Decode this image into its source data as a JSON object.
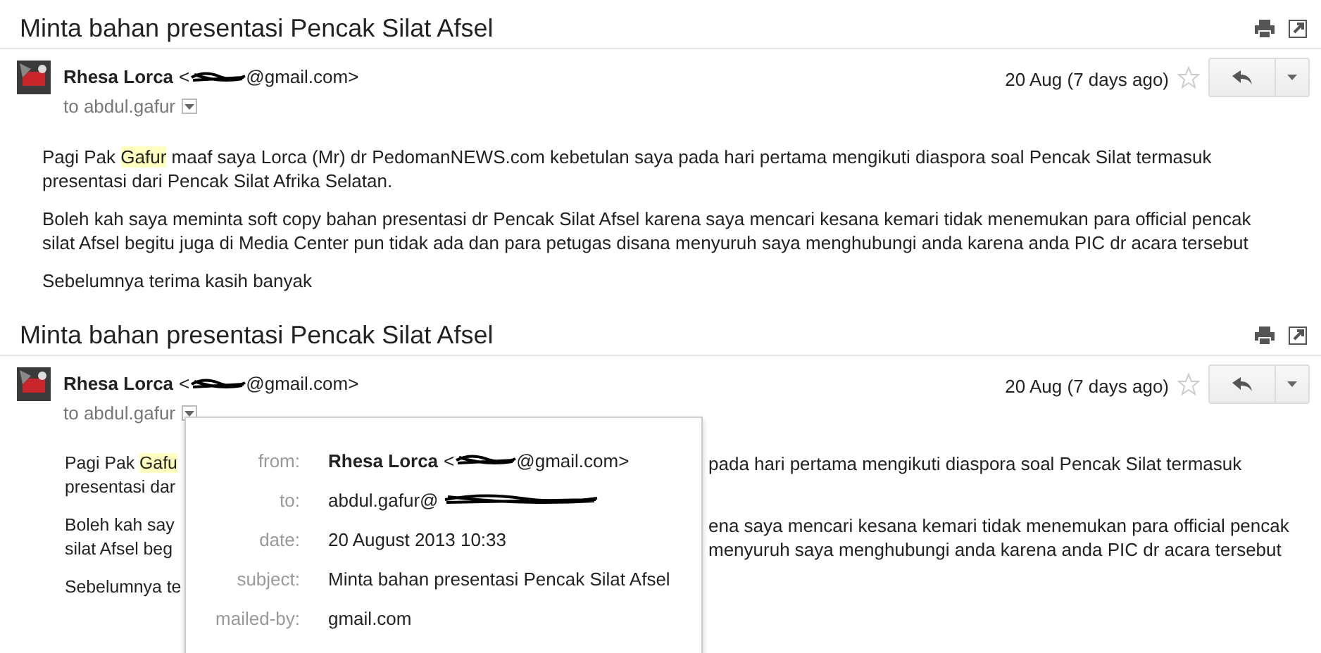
{
  "threads": [
    {
      "subject": "Minta bahan presentasi Pencak Silat Afsel",
      "sender_name": "Rhesa Lorca",
      "email_open": "<",
      "email_domain": "@gmail.com>",
      "date": "20 Aug (7 days ago)",
      "starred": false,
      "recipient": "to abdul.gafur",
      "paragraphs": [
        [
          {
            "text": "Pagi Pak ",
            "highlighted": false
          },
          {
            "text": "Gafur",
            "highlighted": true
          },
          {
            "text": " maaf saya Lorca (Mr) dr PedomanNEWS.com kebetulan saya pada hari pertama mengikuti diaspora soal Pencak Silat termasuk presentasi dari Pencak Silat Afrika Selatan.",
            "highlighted": false
          }
        ],
        [
          {
            "text": "Boleh kah saya meminta soft copy bahan presentasi dr Pencak Silat Afsel karena saya mencari kesana kemari tidak menemukan para official pencak silat Afsel begitu juga di Media Center  pun tidak ada dan para petugas disana menyuruh saya menghubungi anda karena anda PIC dr acara tersebut",
            "highlighted": false
          }
        ],
        [
          {
            "text": "Sebelumnya terima kasih banyak",
            "highlighted": false
          }
        ]
      ]
    },
    {
      "subject": "Minta bahan presentasi Pencak Silat Afsel",
      "sender_name": "Rhesa Lorca",
      "email_open": "<",
      "email_domain": "@gmail.com>",
      "date": "20 Aug (7 days ago)",
      "starred": false,
      "recipient": "to abdul.gafur",
      "visible_paragraphs": [
        [
          {
            "left": [
              {
                "text": "Pagi Pak ",
                "highlighted": false
              },
              {
                "text": "Gafu",
                "highlighted": true
              }
            ],
            "right": "pada hari pertama mengikuti diaspora soal Pencak Silat termasuk"
          },
          {
            "left": [
              {
                "text": "presentasi dar",
                "highlighted": false
              }
            ]
          }
        ],
        [
          {
            "left": [
              {
                "text": "Boleh kah say",
                "highlighted": false
              }
            ],
            "right": "ena saya mencari kesana kemari tidak menemukan para official pencak"
          },
          {
            "left": [
              {
                "text": "silat Afsel beg",
                "highlighted": false
              }
            ],
            "right": "menyuruh saya menghubungi anda karena anda PIC dr acara tersebut"
          }
        ],
        [
          {
            "left": [
              {
                "text": "Sebelumnya te",
                "highlighted": false
              }
            ]
          }
        ]
      ],
      "details_popup": [
        {
          "label": "from:",
          "value": "Rhesa Lorca",
          "kind": "sender",
          "email_open": "<",
          "email_domain": "@gmail.com>"
        },
        {
          "label": "to:",
          "value": "abdul.gafur@",
          "kind": "redacted"
        },
        {
          "label": "date:",
          "value": "20 August 2013 10:33",
          "kind": "plain"
        },
        {
          "label": "subject:",
          "value": "Minta bahan presentasi Pencak Silat Afsel",
          "kind": "plain"
        },
        {
          "label": "mailed-by:",
          "value": "gmail.com",
          "kind": "plain"
        }
      ]
    }
  ]
}
